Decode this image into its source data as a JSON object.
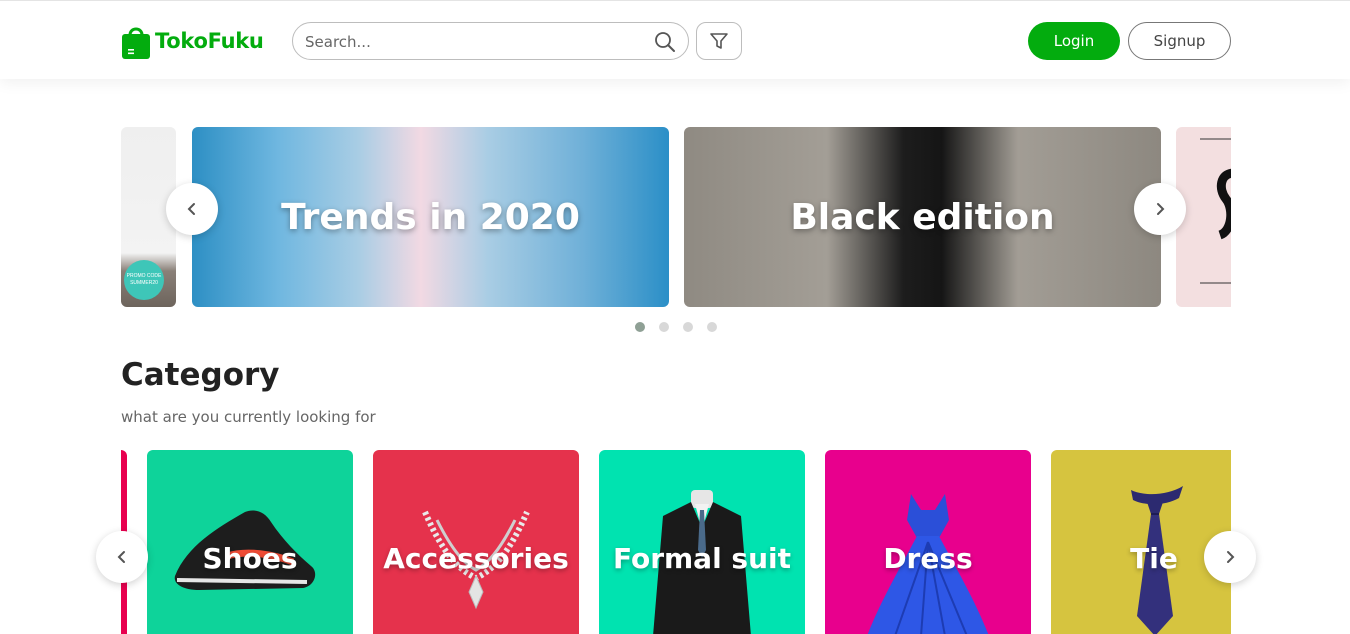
{
  "header": {
    "brand": "TokoFuku",
    "search_placeholder": "Search...",
    "login_label": "Login",
    "signup_label": "Signup"
  },
  "banner": {
    "slides": [
      {
        "title": ""
      },
      {
        "title": "Trends in 2020"
      },
      {
        "title": "Black edition"
      },
      {
        "title": ""
      }
    ],
    "promo_badge": "PROMO CODE SUMMER20",
    "dots": 4,
    "active_dot": 0
  },
  "category": {
    "title": "Category",
    "subtitle": "what are you currently looking for",
    "items": [
      {
        "label": "Shoes",
        "color": "#0ed39a"
      },
      {
        "label": "Accessories",
        "color": "#e5324c"
      },
      {
        "label": "Formal suit",
        "color": "#00e3b0"
      },
      {
        "label": "Dress",
        "color": "#e8008d"
      },
      {
        "label": "Tie",
        "color": "#d6c43f"
      }
    ]
  },
  "colors": {
    "brand_green": "#03ac0e"
  },
  "icons": [
    "shopping-bag-icon",
    "search-icon",
    "filter-icon",
    "chevron-left-icon",
    "chevron-right-icon"
  ]
}
